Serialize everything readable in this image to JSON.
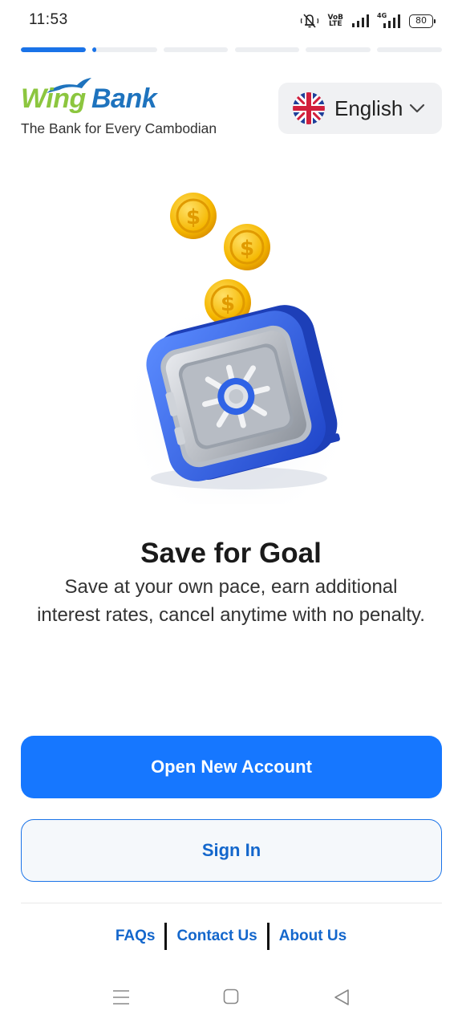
{
  "status_bar": {
    "time": "11:53",
    "lte_label_top": "VoB",
    "lte_label_bottom": "LTE",
    "network_label": "4G",
    "battery_level": "80"
  },
  "onboarding": {
    "total_steps": 6,
    "current_step": 1,
    "current_step_progress": 0.3
  },
  "header": {
    "brand_word_1": "Wing",
    "brand_word_2": "Bank",
    "tagline": "The Bank for Every Cambodian",
    "language": {
      "selected": "English",
      "flag_icon": "uk-flag-icon"
    }
  },
  "slide": {
    "title": "Save for Goal",
    "description": "Save at your own pace, earn additional interest rates, cancel anytime with no penalty."
  },
  "actions": {
    "primary_label": "Open New Account",
    "secondary_label": "Sign In"
  },
  "footer": {
    "links": [
      "FAQs",
      "Contact Us",
      "About Us"
    ]
  },
  "colors": {
    "primary": "#1677ff",
    "link": "#1467cc",
    "brand_green": "#8cc63f",
    "brand_blue": "#1e73be",
    "safe_blue": "#2f63e6",
    "coin_gold": "#f5b700"
  }
}
